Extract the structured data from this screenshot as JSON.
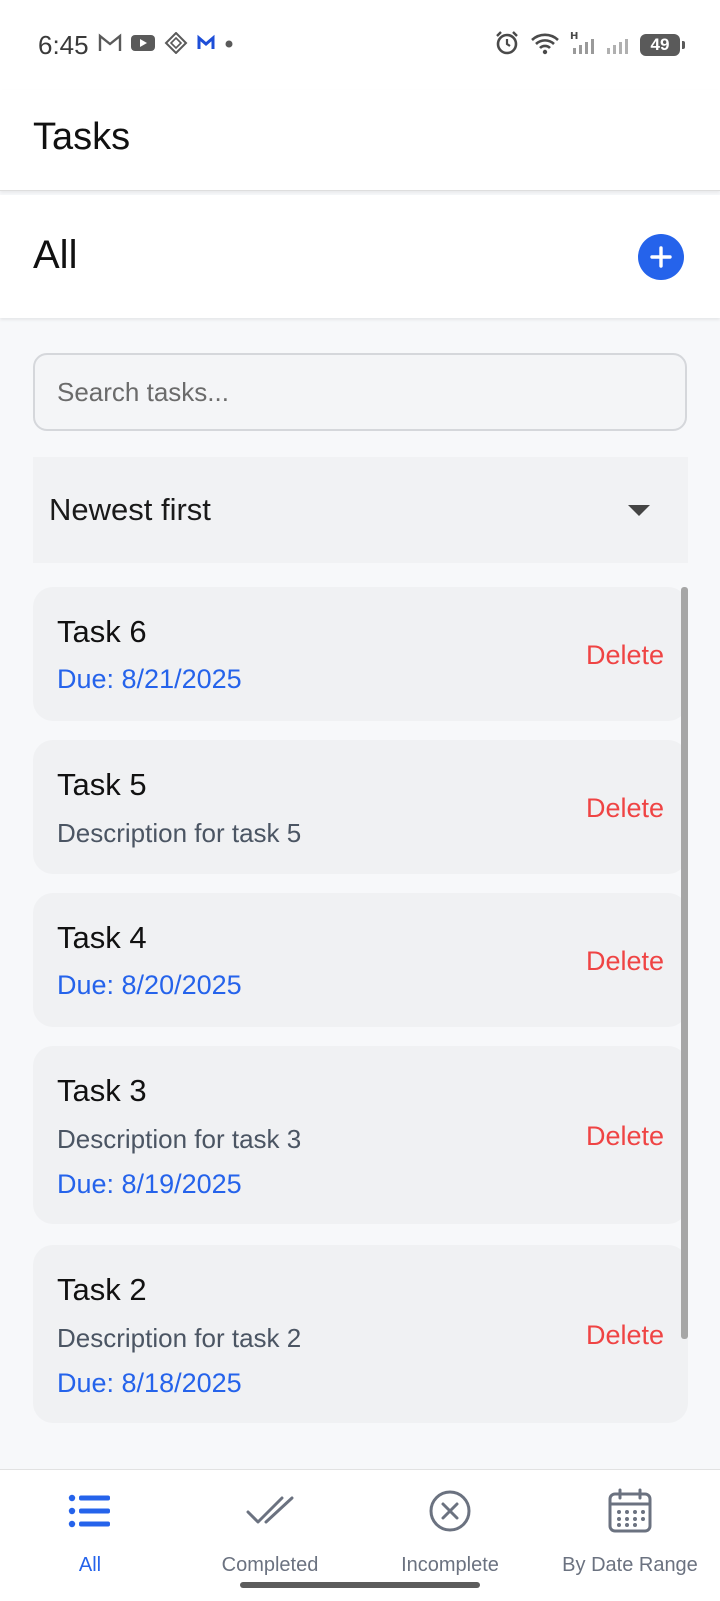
{
  "status_bar": {
    "time": "6:45",
    "battery_level": "49",
    "left_icons": [
      "gmail-icon",
      "youtube-icon",
      "app-diamond-icon",
      "m-app-icon",
      "dot-icon"
    ],
    "right_icons": [
      "alarm-icon",
      "wifi-icon",
      "signal-h-icon",
      "signal-icon",
      "battery-icon"
    ]
  },
  "header": {
    "title": "Tasks"
  },
  "filter_header": {
    "title": "All",
    "add_icon": "plus-icon"
  },
  "search": {
    "placeholder": "Search tasks...",
    "value": ""
  },
  "sort": {
    "selected": "Newest first"
  },
  "tasks": [
    {
      "title": "Task 6",
      "description": "",
      "due": "Due: 8/21/2025",
      "delete_label": "Delete"
    },
    {
      "title": "Task 5",
      "description": "Description for task 5",
      "due": "",
      "delete_label": "Delete"
    },
    {
      "title": "Task 4",
      "description": "",
      "due": "Due: 8/20/2025",
      "delete_label": "Delete"
    },
    {
      "title": "Task 3",
      "description": "Description for task 3",
      "due": "Due: 8/19/2025",
      "delete_label": "Delete"
    },
    {
      "title": "Task 2",
      "description": "Description for task 2",
      "due": "Due: 8/18/2025",
      "delete_label": "Delete"
    }
  ],
  "bottom_nav": {
    "items": [
      {
        "label": "All",
        "icon": "list-icon",
        "active": true
      },
      {
        "label": "Completed",
        "icon": "double-check-icon",
        "active": false
      },
      {
        "label": "Incomplete",
        "icon": "circle-x-icon",
        "active": false
      },
      {
        "label": "By Date Range",
        "icon": "calendar-icon",
        "active": false
      }
    ]
  },
  "colors": {
    "accent": "#2563eb",
    "danger": "#ef4444",
    "muted_text": "#4b5563",
    "inactive_nav": "#6b7280"
  }
}
